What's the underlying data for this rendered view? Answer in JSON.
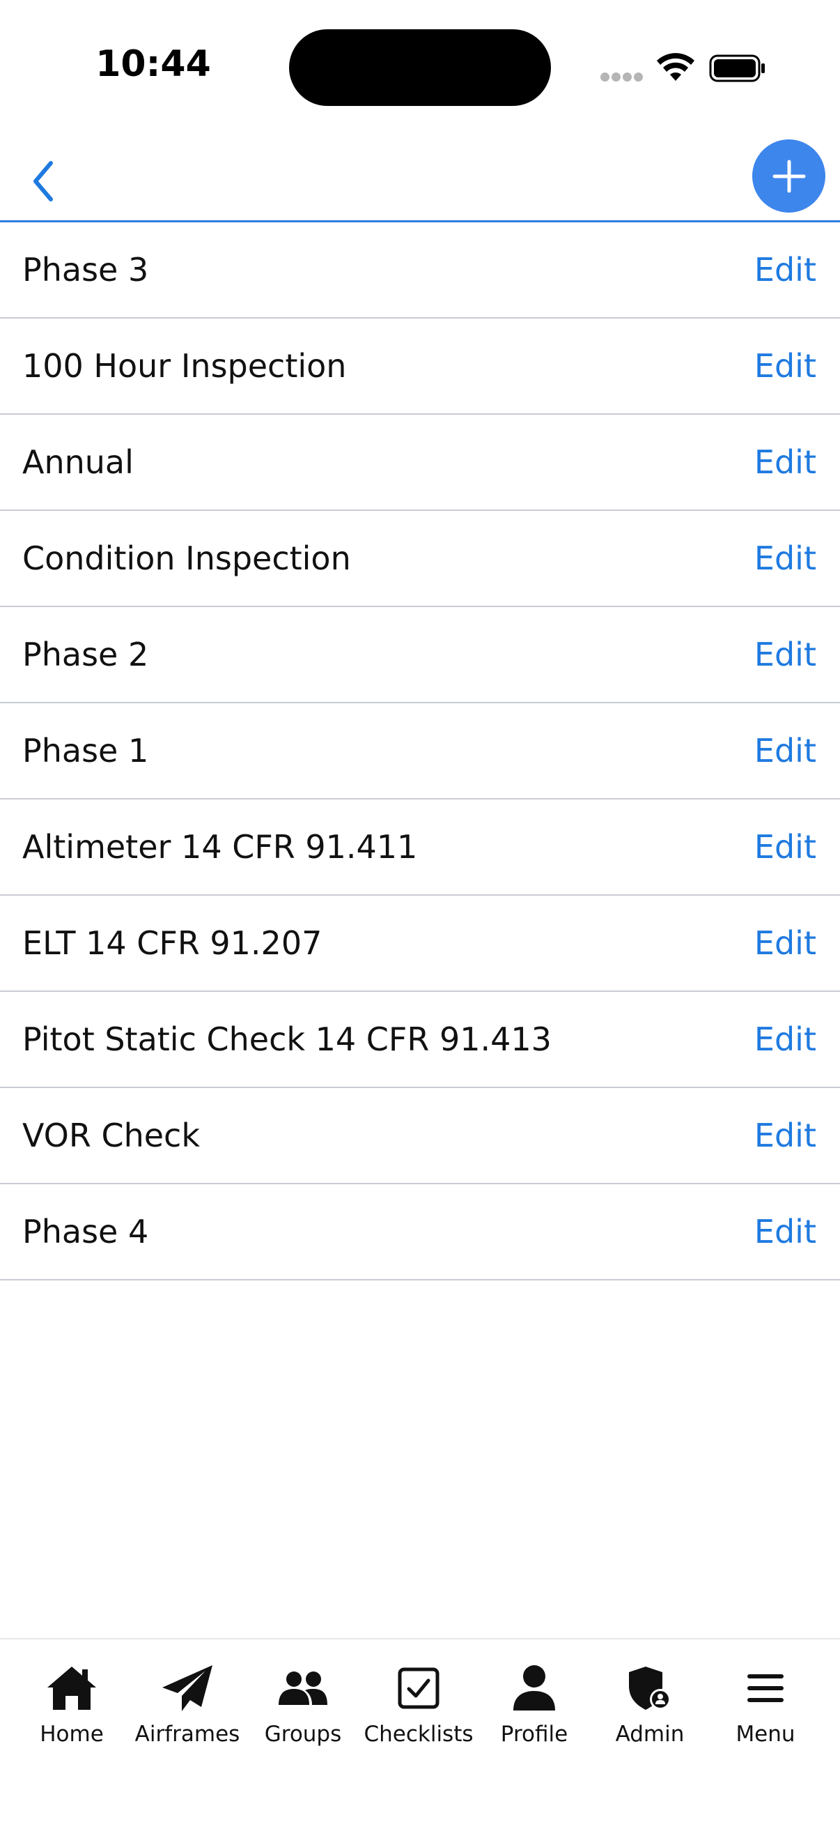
{
  "status_bar": {
    "time": "10:44"
  },
  "nav": {
    "back_icon": "chevron-left-icon",
    "add_icon": "plus-icon",
    "accent_color": "#2f7de1"
  },
  "list": {
    "edit_color": "#1f7ae0",
    "items": [
      {
        "title": "Phase 3",
        "action": "Edit"
      },
      {
        "title": "100 Hour Inspection",
        "action": "Edit"
      },
      {
        "title": "Annual",
        "action": "Edit"
      },
      {
        "title": "Condition Inspection",
        "action": "Edit"
      },
      {
        "title": "Phase 2",
        "action": "Edit"
      },
      {
        "title": "Phase 1",
        "action": "Edit"
      },
      {
        "title": "Altimeter 14 CFR 91.411",
        "action": "Edit"
      },
      {
        "title": "ELT 14 CFR 91.207",
        "action": "Edit"
      },
      {
        "title": "Pitot Static Check 14 CFR 91.413",
        "action": "Edit"
      },
      {
        "title": "VOR Check",
        "action": "Edit"
      },
      {
        "title": "Phase 4",
        "action": "Edit"
      }
    ]
  },
  "tab_bar": {
    "tabs": [
      {
        "label": "Home",
        "icon": "home-icon"
      },
      {
        "label": "Airframes",
        "icon": "paper-plane-icon"
      },
      {
        "label": "Groups",
        "icon": "users-icon"
      },
      {
        "label": "Checklists",
        "icon": "checkbox-icon"
      },
      {
        "label": "Profile",
        "icon": "user-icon"
      },
      {
        "label": "Admin",
        "icon": "shield-user-icon"
      },
      {
        "label": "Menu",
        "icon": "menu-icon"
      }
    ]
  }
}
